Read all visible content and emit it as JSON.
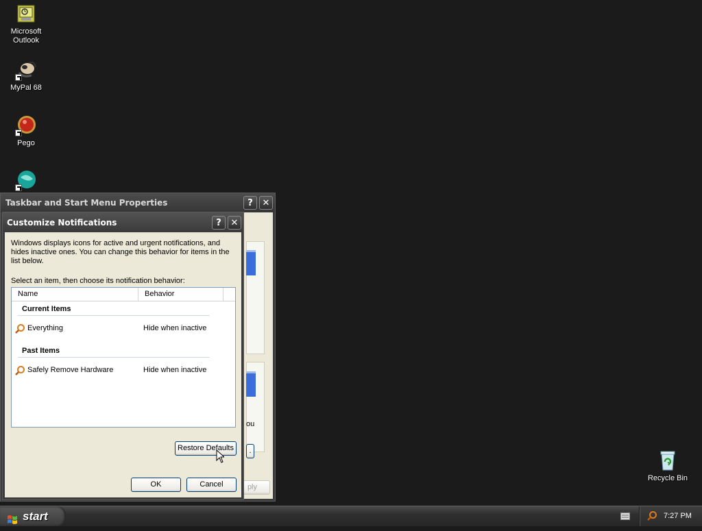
{
  "desktop": {
    "icons": [
      {
        "label": "Microsoft Outlook"
      },
      {
        "label": "MyPal 68"
      },
      {
        "label": "Pego"
      },
      {
        "label": ""
      },
      {
        "label": "Recycle Bin"
      }
    ]
  },
  "properties_dialog": {
    "title": "Taskbar and Start Menu Properties",
    "help_label": "?",
    "close_label": "✕",
    "partial_text": "ou",
    "apply_label": "ply"
  },
  "customize_dialog": {
    "title": "Customize Notifications",
    "help_label": "?",
    "close_label": "✕",
    "description": "Windows displays icons for active and urgent notifications, and hides inactive ones. You can change this behavior for items in the list below.",
    "select_label": "Select an item, then choose its notification behavior:",
    "columns": {
      "name": "Name",
      "behavior": "Behavior"
    },
    "groups": [
      {
        "title": "Current Items",
        "items": [
          {
            "name": "Everything",
            "behavior": "Hide when inactive"
          }
        ]
      },
      {
        "title": "Past Items",
        "items": [
          {
            "name": "Safely Remove Hardware",
            "behavior": "Hide when inactive"
          }
        ]
      }
    ],
    "restore_defaults_label": "Restore Defaults",
    "ok_label": "OK",
    "cancel_label": "Cancel"
  },
  "taskbar": {
    "start_label": "start",
    "clock": "7:27 PM"
  },
  "colors": {
    "desktop_bg": "#1b1b1b",
    "dialog_bg": "#ece9d8",
    "titlebar": "#3c3c3c",
    "search_icon_orange": "#e07a1f"
  }
}
